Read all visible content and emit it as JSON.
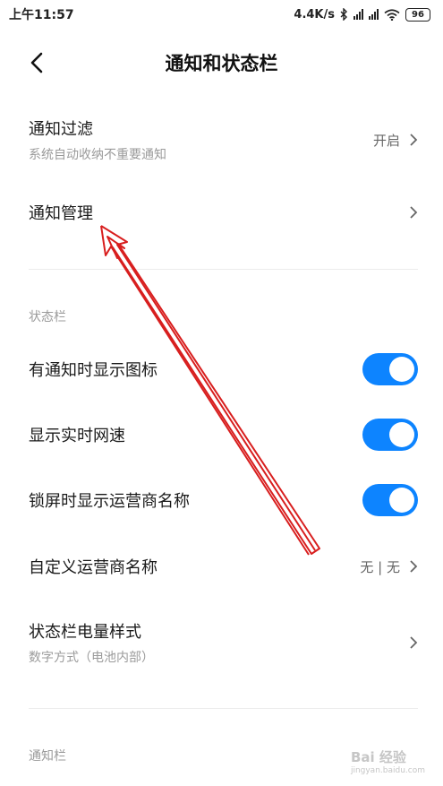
{
  "status_bar": {
    "time": "上午11:57",
    "net_speed": "4.4K/s",
    "battery": "96"
  },
  "header": {
    "title": "通知和状态栏"
  },
  "notification_filter": {
    "label": "通知过滤",
    "subtitle": "系统自动收纳不重要通知",
    "value": "开启"
  },
  "notification_management": {
    "label": "通知管理"
  },
  "status_bar_section": {
    "title": "状态栏",
    "items": [
      {
        "label": "有通知时显示图标",
        "enabled": true
      },
      {
        "label": "显示实时网速",
        "enabled": true
      },
      {
        "label": "锁屏时显示运营商名称",
        "enabled": true
      }
    ],
    "carrier_name": {
      "label": "自定义运营商名称",
      "value": "无 | 无"
    },
    "battery_style": {
      "label": "状态栏电量样式",
      "subtitle": "数字方式（电池内部）"
    }
  },
  "notification_bar_section": {
    "title": "通知栏"
  },
  "watermark": {
    "text": "Bai 经验",
    "url": "jingyan.baidu.com"
  },
  "colors": {
    "toggle_on": "#0d84ff",
    "annotation_arrow": "#d81e1e"
  }
}
